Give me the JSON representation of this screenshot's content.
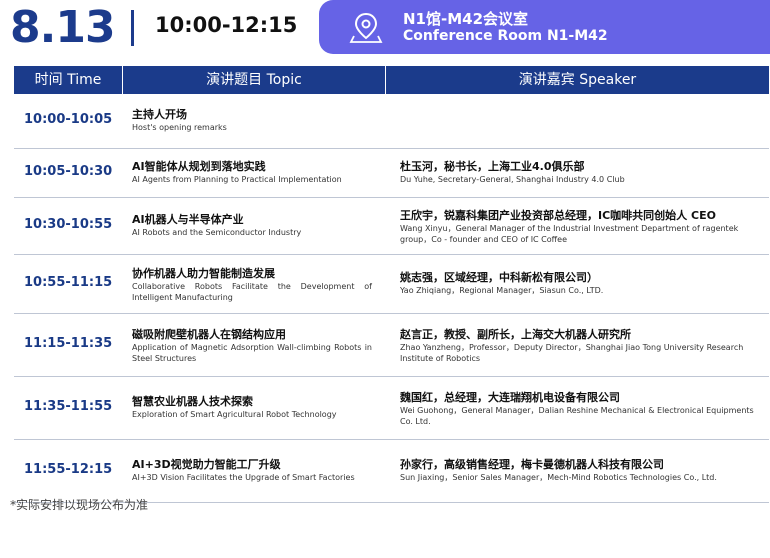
{
  "header": {
    "date": "8.13",
    "time_range": "10:00-12:15",
    "room_cn": "N1馆-M42会议室",
    "room_en": "Conference Room N1-M42",
    "accent_color": "#6663e6",
    "primary_color": "#1c3b8c",
    "location_icon": "location-pin-icon"
  },
  "table": {
    "columns": [
      "时间 Time",
      "演讲题目 Topic",
      "演讲嘉宾 Speaker"
    ],
    "rows": [
      {
        "time": "10:00-10:05",
        "topic_cn": "主持人开场",
        "topic_en": "Host's opening remarks",
        "speaker_cn": "",
        "speaker_en": ""
      },
      {
        "time": "10:05-10:30",
        "topic_cn": "AI智能体从规划到落地实践",
        "topic_en": "AI Agents from Planning to Practical Implementation",
        "speaker_cn": "杜玉河，秘书长，上海工业4.0俱乐部",
        "speaker_en": "Du Yuhe, Secretary-General, Shanghai Industry 4.0 Club"
      },
      {
        "time": "10:30-10:55",
        "topic_cn": "AI机器人与半导体产业",
        "topic_en": "AI Robots and the Semiconductor Industry",
        "speaker_cn": "王欣宇，锐嘉科集团产业投资部总经理，IC咖啡共同创始人 CEO",
        "speaker_en": "Wang Xinyu，General Manager of the Industrial Investment Department of ragentek group，Co - founder and CEO of IC Coffee"
      },
      {
        "time": "10:55-11:15",
        "topic_cn": "协作机器人助力智能制造发展",
        "topic_en": "Collaborative Robots Facilitate the Development of Intelligent Manufacturing",
        "speaker_cn": "姚志强，区域经理，中科新松有限公司）",
        "speaker_en": "Yao Zhiqiang，Regional Manager，Siasun Co., LTD."
      },
      {
        "time": "11:15-11:35",
        "topic_cn": "磁吸附爬壁机器人在钢结构应用",
        "topic_en": "Application of Magnetic Adsorption Wall-climbing Robots in Steel Structures",
        "speaker_cn": "赵言正，教授、副所长，上海交大机器人研究所",
        "speaker_en": "Zhao Yanzheng，Professor，Deputy Director，Shanghai Jiao Tong University Research Institute of Robotics"
      },
      {
        "time": "11:35-11:55",
        "topic_cn": "智慧农业机器人技术探索",
        "topic_en": "Exploration of Smart Agricultural Robot Technology",
        "speaker_cn": "魏国红，总经理，大连瑞翔机电设备有限公司",
        "speaker_en": "Wei Guohong，General Manager，Dalian Reshine Mechanical & Electronical Equipments Co. Ltd."
      },
      {
        "time": "11:55-12:15",
        "topic_cn": "AI+3D视觉助力智能工厂升级",
        "topic_en": "AI+3D Vision Facilitates the Upgrade of Smart Factories",
        "speaker_cn": "孙家行，高级销售经理，梅卡曼德机器人科技有限公司",
        "speaker_en": "Sun Jiaxing，Senior Sales Manager，Mech-Mind Robotics Technologies Co., Ltd."
      }
    ]
  },
  "footnote": "*实际安排以现场公布为准"
}
